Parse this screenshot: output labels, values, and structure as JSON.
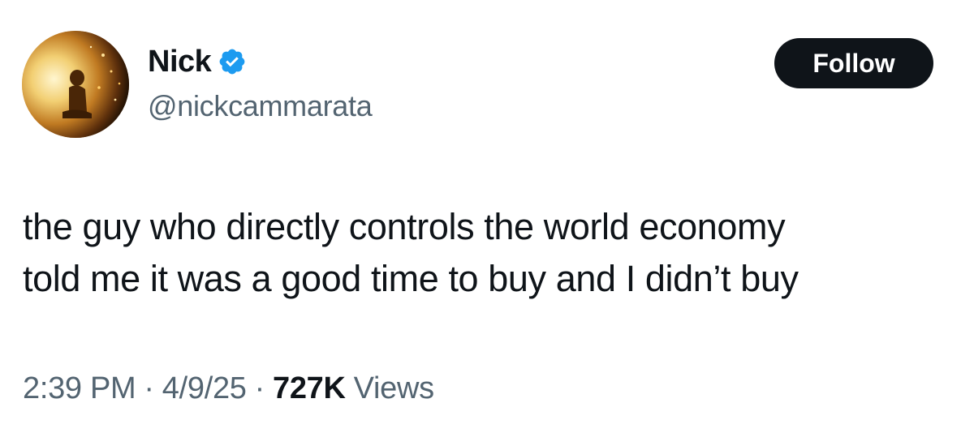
{
  "author": {
    "display_name": "Nick",
    "handle": "@nickcammarata",
    "verified": true,
    "avatar_icon": "avatar-image"
  },
  "follow_button": {
    "label": "Follow"
  },
  "tweet": {
    "text": "the guy who directly controls the world economy\ntold me it was a good time to buy and I didn’t buy"
  },
  "meta": {
    "time": "2:39 PM",
    "separator": "·",
    "date": "4/9/25",
    "views_count": "727K",
    "views_label": "Views"
  },
  "colors": {
    "verified_badge": "#1d9bf0",
    "follow_button_bg": "#0f1419",
    "secondary_text": "#536471",
    "primary_text": "#0f1419"
  }
}
